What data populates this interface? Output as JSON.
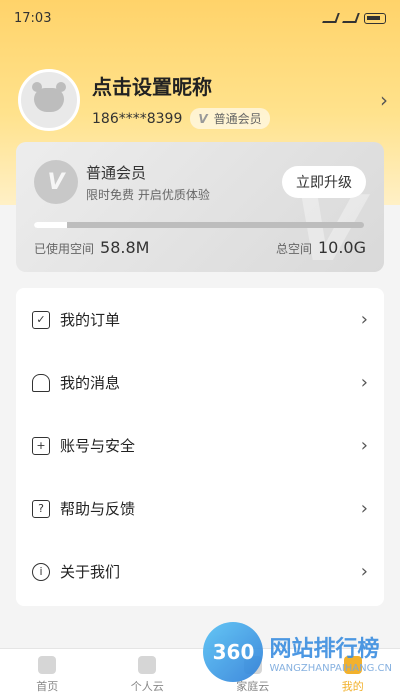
{
  "status": {
    "time": "17:03",
    "battery": "86"
  },
  "profile": {
    "nickname": "点击设置昵称",
    "phone": "186****8399",
    "member_level": "普通会员"
  },
  "member_card": {
    "level": "普通会员",
    "sub": "限时免费 开启优质体验",
    "upgrade": "立即升级",
    "used_label": "已使用空间",
    "used_value": "58.8M",
    "total_label": "总空间",
    "total_value": "10.0G",
    "used_fraction": 0.0057
  },
  "menu": {
    "items": [
      {
        "label": "我的订单",
        "icon": "order-icon"
      },
      {
        "label": "我的消息",
        "icon": "bell-icon"
      },
      {
        "label": "账号与安全",
        "icon": "shield-icon"
      },
      {
        "label": "帮助与反馈",
        "icon": "help-icon"
      },
      {
        "label": "关于我们",
        "icon": "info-icon"
      }
    ]
  },
  "tabs": [
    {
      "label": "首页"
    },
    {
      "label": "个人云"
    },
    {
      "label": "家庭云"
    },
    {
      "label": "我的"
    }
  ],
  "watermark": {
    "logo": "360",
    "name": "网站排行榜",
    "domain": "WANGZHANPAIHANG.CN"
  },
  "colors": {
    "accent": "#f2b12d",
    "header": "#ffd36a"
  }
}
